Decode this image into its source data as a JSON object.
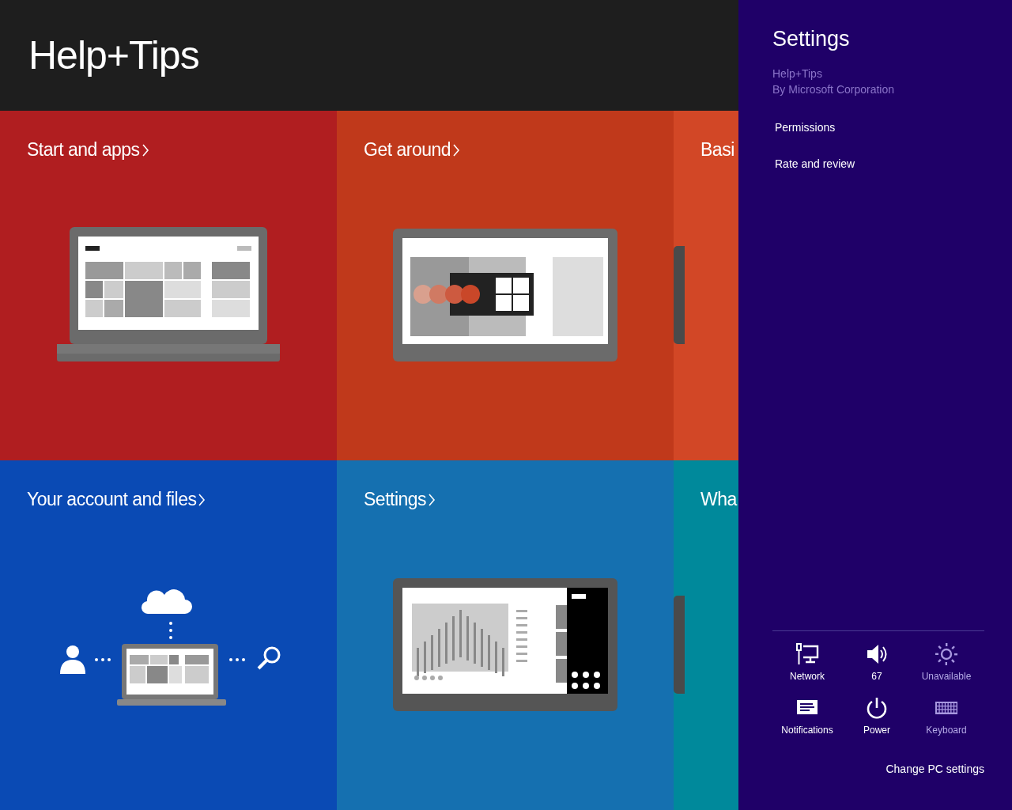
{
  "app": {
    "title": "Help+Tips"
  },
  "tiles": [
    {
      "title": "Start and apps",
      "color": "#b01e20",
      "kind": "laptop"
    },
    {
      "title": "Get around",
      "color": "#c0391b",
      "kind": "tablet-swipe"
    },
    {
      "title": "Basi",
      "color": "#d24726",
      "kind": "partial"
    },
    {
      "title": "Your account and files",
      "color": "#0a4ab4",
      "kind": "account"
    },
    {
      "title": "Settings",
      "color": "#1570b0",
      "kind": "tablet-chart"
    },
    {
      "title": "Wha",
      "color": "#00899b",
      "kind": "partial"
    }
  ],
  "settings_pane": {
    "title": "Settings",
    "app_name": "Help+Tips",
    "publisher": "By Microsoft Corporation",
    "links": [
      "Permissions",
      "Rate and review"
    ],
    "quick_settings": [
      {
        "kind": "network",
        "label": "Network",
        "disabled": false
      },
      {
        "kind": "volume",
        "label": "67",
        "disabled": false
      },
      {
        "kind": "brightness",
        "label": "Unavailable",
        "disabled": true
      },
      {
        "kind": "notifications",
        "label": "Notifications",
        "disabled": false
      },
      {
        "kind": "power",
        "label": "Power",
        "disabled": false
      },
      {
        "kind": "keyboard",
        "label": "Keyboard",
        "disabled": true
      }
    ],
    "footer_link": "Change PC settings"
  }
}
